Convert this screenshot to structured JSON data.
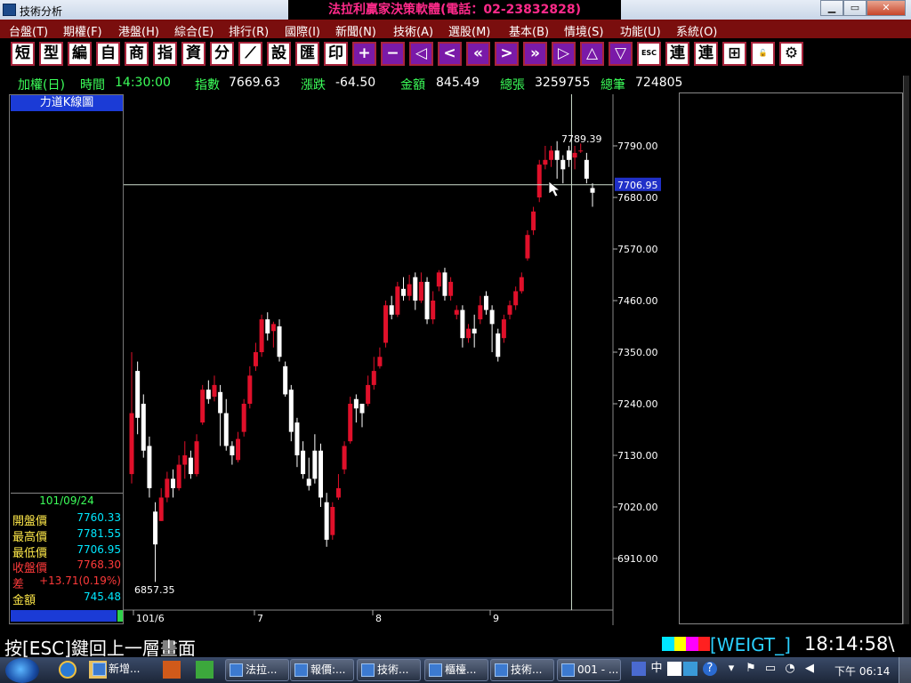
{
  "window": {
    "title": "技術分析",
    "promo": "法拉利贏家決策軟體(電話：02-23832828)",
    "minimize": "▁",
    "maximize": "▭",
    "close": "✕"
  },
  "menu": [
    "台盤(T)",
    "期權(F)",
    "港盤(H)",
    "綜合(E)",
    "排行(R)",
    "國際(I)",
    "新聞(N)",
    "技術(A)",
    "選股(M)",
    "基本(B)",
    "情境(S)",
    "功能(U)",
    "系統(O)"
  ],
  "toolbar": [
    "短",
    "型",
    "編",
    "自",
    "商",
    "指",
    "資",
    "分",
    "⟋",
    "設",
    "匯",
    "印",
    "+",
    "−",
    "◁",
    "<",
    "«",
    ">",
    "»",
    "▷",
    "△",
    "▽",
    "ESC",
    "連",
    "連",
    "⊞",
    "🔓",
    "⚙"
  ],
  "info": {
    "product": "加權(日)",
    "time_label": "時間",
    "time": "14:30:00",
    "index_label": "指數",
    "index": "7669.63",
    "change_label": "漲跌",
    "change": "-64.50",
    "amount_label": "金額",
    "amount": "845.49",
    "vol_label": "總張",
    "vol": "3259755",
    "trades_label": "總筆",
    "trades": "724805"
  },
  "panel": {
    "title": "力道K線圖",
    "date": "101/09/24",
    "rows": [
      {
        "label": "開盤價",
        "value": "7760.33",
        "lcolor": "#ffe94a",
        "vcolor": "#00e8ff"
      },
      {
        "label": "最高價",
        "value": "7781.55",
        "lcolor": "#ffe94a",
        "vcolor": "#00e8ff"
      },
      {
        "label": "最低價",
        "value": "7706.95",
        "lcolor": "#ffe94a",
        "vcolor": "#00e8ff"
      },
      {
        "label": "收盤價",
        "value": "7768.30",
        "lcolor": "#ff3a3a",
        "vcolor": "#ff3a3a"
      },
      {
        "label": "差",
        "value": "+13.71(0.19%)",
        "lcolor": "#ff3a3a",
        "vcolor": "#ff3a3a"
      },
      {
        "label": "金額",
        "value": "745.48",
        "lcolor": "#ffe94a",
        "vcolor": "#00e8ff"
      }
    ]
  },
  "chart_data": {
    "type": "candlestick",
    "title": "力道K線圖",
    "yticks": [
      6910,
      7020,
      7130,
      7240,
      7350,
      7460,
      7570,
      7680,
      7790
    ],
    "ytick_labels": [
      "6910.00",
      "7020.00",
      "7130.00",
      "7240.00",
      "7350.00",
      "7460.00",
      "7570.00",
      "7680.00",
      "7790.00"
    ],
    "xtick_labels": [
      "101/6",
      "7",
      "8",
      "9"
    ],
    "annotation_high": "7789.39",
    "annotation_low": "6857.35",
    "cursor_value": "7706.95",
    "colors": {
      "up": "#e0102a",
      "down": "#ffffff",
      "grid": "#555555"
    },
    "candles": [
      [
        7090,
        7220,
        7070,
        7350
      ],
      [
        7310,
        7210,
        7175,
        7330
      ],
      [
        7240,
        7140,
        7125,
        7260
      ],
      [
        7150,
        7060,
        7040,
        7170
      ],
      [
        7010,
        6940,
        6860,
        7030
      ],
      [
        6990,
        7040,
        6990,
        7060
      ],
      [
        7040,
        7080,
        7030,
        7095
      ],
      [
        7080,
        7060,
        7040,
        7100
      ],
      [
        7060,
        7110,
        7055,
        7130
      ],
      [
        7110,
        7130,
        7080,
        7160
      ],
      [
        7125,
        7090,
        7080,
        7140
      ],
      [
        7090,
        7160,
        7085,
        7175
      ],
      [
        7200,
        7270,
        7195,
        7280
      ],
      [
        7270,
        7250,
        7240,
        7290
      ],
      [
        7255,
        7280,
        7245,
        7300
      ],
      [
        7265,
        7220,
        7150,
        7280
      ],
      [
        7220,
        7150,
        7140,
        7250
      ],
      [
        7150,
        7130,
        7110,
        7160
      ],
      [
        7120,
        7165,
        7115,
        7180
      ],
      [
        7180,
        7240,
        7170,
        7250
      ],
      [
        7240,
        7300,
        7230,
        7320
      ],
      [
        7320,
        7350,
        7310,
        7370
      ],
      [
        7350,
        7420,
        7340,
        7430
      ],
      [
        7420,
        7390,
        7375,
        7435
      ],
      [
        7395,
        7410,
        7360,
        7415
      ],
      [
        7405,
        7340,
        7330,
        7420
      ],
      [
        7320,
        7260,
        7255,
        7330
      ],
      [
        7270,
        7180,
        7160,
        7280
      ],
      [
        7200,
        7130,
        7105,
        7210
      ],
      [
        7140,
        7090,
        7080,
        7160
      ],
      [
        7080,
        7065,
        7055,
        7125
      ],
      [
        7140,
        7080,
        7070,
        7175
      ],
      [
        7140,
        7040,
        7020,
        7155
      ],
      [
        7030,
        6950,
        6935,
        7050
      ],
      [
        6960,
        7020,
        6950,
        7030
      ],
      [
        7040,
        7060,
        7035,
        7090
      ],
      [
        7100,
        7150,
        7090,
        7160
      ],
      [
        7160,
        7240,
        7155,
        7255
      ],
      [
        7250,
        7230,
        7200,
        7260
      ],
      [
        7240,
        7220,
        7190,
        7240
      ],
      [
        7240,
        7280,
        7235,
        7300
      ],
      [
        7280,
        7310,
        7270,
        7340
      ],
      [
        7320,
        7340,
        7315,
        7360
      ],
      [
        7370,
        7450,
        7360,
        7460
      ],
      [
        7450,
        7430,
        7420,
        7470
      ],
      [
        7430,
        7490,
        7425,
        7500
      ],
      [
        7485,
        7470,
        7460,
        7510
      ],
      [
        7470,
        7495,
        7460,
        7515
      ],
      [
        7510,
        7460,
        7440,
        7520
      ],
      [
        7460,
        7500,
        7455,
        7520
      ],
      [
        7500,
        7420,
        7410,
        7510
      ],
      [
        7420,
        7460,
        7410,
        7480
      ],
      [
        7490,
        7520,
        7480,
        7525
      ],
      [
        7520,
        7470,
        7460,
        7530
      ],
      [
        7470,
        7500,
        7460,
        7510
      ],
      [
        7430,
        7440,
        7420,
        7450
      ],
      [
        7440,
        7380,
        7360,
        7450
      ],
      [
        7380,
        7400,
        7370,
        7410
      ],
      [
        7400,
        7390,
        7360,
        7430
      ],
      [
        7420,
        7450,
        7410,
        7470
      ],
      [
        7470,
        7440,
        7430,
        7480
      ],
      [
        7440,
        7410,
        7350,
        7450
      ],
      [
        7390,
        7340,
        7330,
        7400
      ],
      [
        7380,
        7420,
        7370,
        7430
      ],
      [
        7430,
        7450,
        7420,
        7460
      ],
      [
        7450,
        7480,
        7440,
        7490
      ],
      [
        7480,
        7510,
        7475,
        7520
      ],
      [
        7550,
        7600,
        7545,
        7610
      ],
      [
        7610,
        7650,
        7600,
        7660
      ],
      [
        7680,
        7750,
        7670,
        7760
      ],
      [
        7750,
        7760,
        7740,
        7790
      ],
      [
        7760,
        7780,
        7745,
        7790
      ],
      [
        7780,
        7760,
        7720,
        7800
      ],
      [
        7760,
        7740,
        7710,
        7770
      ],
      [
        7780,
        7760,
        7745,
        7790
      ],
      [
        7765,
        7775,
        7740,
        7790
      ],
      [
        7780,
        7780,
        7775,
        7795
      ],
      [
        7760,
        7720,
        7710,
        7775
      ],
      [
        7700,
        7690,
        7660,
        7710
      ]
    ]
  },
  "bottom": {
    "hint": "按[ESC]鍵回上一層畫面",
    "weigt": "[WEIGT_]",
    "clock": "18:14:58\\"
  },
  "taskbar": {
    "tasks": [
      "新增...",
      "法拉...",
      "報價:...",
      "技術...",
      "櫃檯...",
      "技術...",
      "001 - ..."
    ],
    "tray": [
      "中",
      "?",
      "下午 06:14"
    ]
  }
}
